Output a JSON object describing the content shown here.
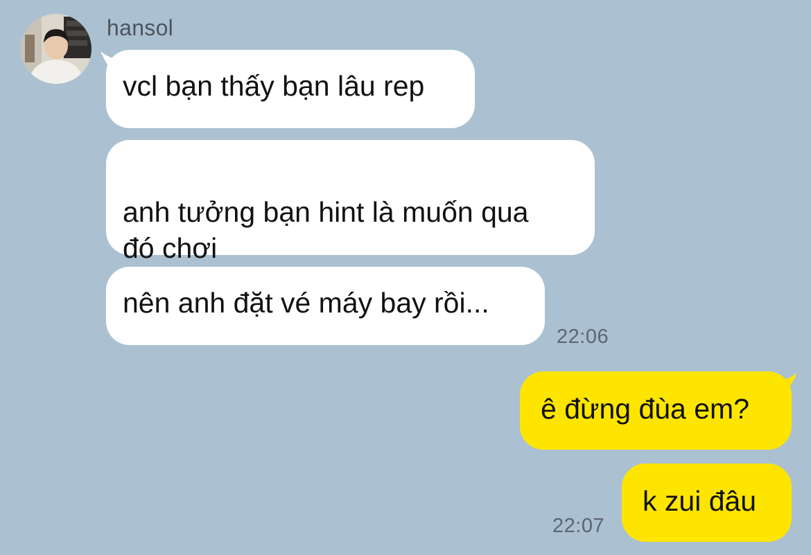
{
  "conversation": {
    "sender": {
      "name": "hansol",
      "avatar": "profile-photo"
    },
    "messages": [
      {
        "direction": "incoming",
        "text": "vcl bạn thấy bạn lâu rep"
      },
      {
        "direction": "incoming",
        "text": "anh tưởng bạn hint là muốn qua\nđó chơi"
      },
      {
        "direction": "incoming",
        "text": "nên anh đặt vé máy bay rồi...",
        "time": "22:06"
      },
      {
        "direction": "outgoing",
        "text": "ê đừng đùa em?"
      },
      {
        "direction": "outgoing",
        "text": "k zui đâu",
        "time": "22:07"
      }
    ]
  },
  "colors": {
    "background": "#abc1d1",
    "incoming_bubble": "#ffffff",
    "outgoing_bubble": "#fee500",
    "name_text": "#4b5560",
    "timestamp_text": "#5b6670"
  }
}
